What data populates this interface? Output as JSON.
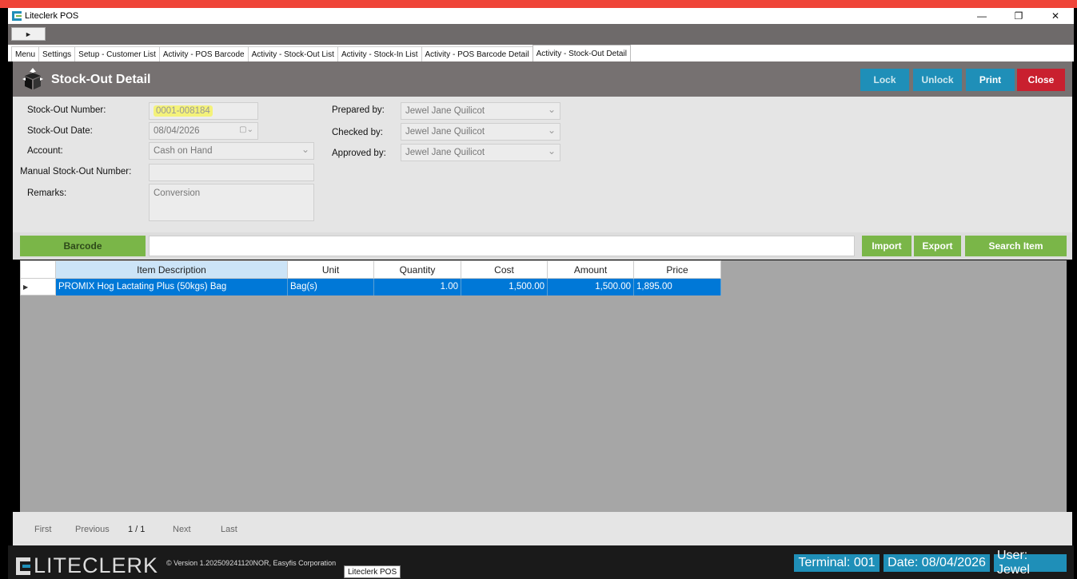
{
  "window": {
    "title": "Liteclerk POS",
    "controls": {
      "minimize": "—",
      "restore": "❐",
      "close": "✕"
    }
  },
  "toolbar": {
    "play": "►"
  },
  "tabs": [
    {
      "label": "Menu"
    },
    {
      "label": "Settings"
    },
    {
      "label": "Setup - Customer List"
    },
    {
      "label": "Activity - POS Barcode"
    },
    {
      "label": "Activity - Stock-Out List"
    },
    {
      "label": "Activity - Stock-In List"
    },
    {
      "label": "Activity - POS Barcode Detail"
    },
    {
      "label": "Activity - Stock-Out Detail",
      "active": true
    }
  ],
  "header": {
    "title": "Stock-Out Detail",
    "icon": "box-with-arrows-icon",
    "buttons": {
      "lock": "Lock",
      "unlock": "Unlock",
      "print": "Print",
      "close": "Close"
    }
  },
  "form": {
    "stock_out_number": {
      "label": "Stock-Out Number:",
      "value": "0001-008184"
    },
    "stock_out_date": {
      "label": "Stock-Out Date:",
      "value": "08/04/2026"
    },
    "account": {
      "label": "Account:",
      "value": "Cash on Hand"
    },
    "manual_number": {
      "label": "Manual Stock-Out Number:",
      "value": ""
    },
    "remarks": {
      "label": "Remarks:",
      "value": "Conversion"
    },
    "prepared_by": {
      "label": "Prepared by:",
      "value": "Jewel Jane Quilicot"
    },
    "checked_by": {
      "label": "Checked by:",
      "value": "Jewel Jane Quilicot"
    },
    "approved_by": {
      "label": "Approved by:",
      "value": "Jewel Jane Quilicot"
    }
  },
  "barcode": {
    "button": "Barcode",
    "input_value": "",
    "import": "Import",
    "export": "Export",
    "search": "Search Item"
  },
  "grid": {
    "columns": [
      "Item Description",
      "Unit",
      "Quantity",
      "Cost",
      "Amount",
      "Price"
    ],
    "rows": [
      {
        "description": "PROMIX Hog Lactating Plus (50kgs) Bag",
        "unit": "Bag(s)",
        "quantity": "1.00",
        "cost": "1,500.00",
        "amount": "1,500.00",
        "price": "1,895.00"
      }
    ]
  },
  "pager": {
    "first": "First",
    "previous": "Previous",
    "page": "1 / 1",
    "next": "Next",
    "last": "Last"
  },
  "footer": {
    "logo": "LITECLERK",
    "version": "© Version 1.202509241120NOR, Easyfis Corporation",
    "tooltip": "Liteclerk POS",
    "terminal": "Terminal: 001",
    "date": "Date: 08/04/2026",
    "user": "User: Jewel"
  },
  "colors": {
    "accent_blue": "#1f8fb8",
    "close_red": "#c9202f",
    "green": "#7ab648",
    "header_gray": "#767171",
    "selected_row": "#0078d7"
  }
}
